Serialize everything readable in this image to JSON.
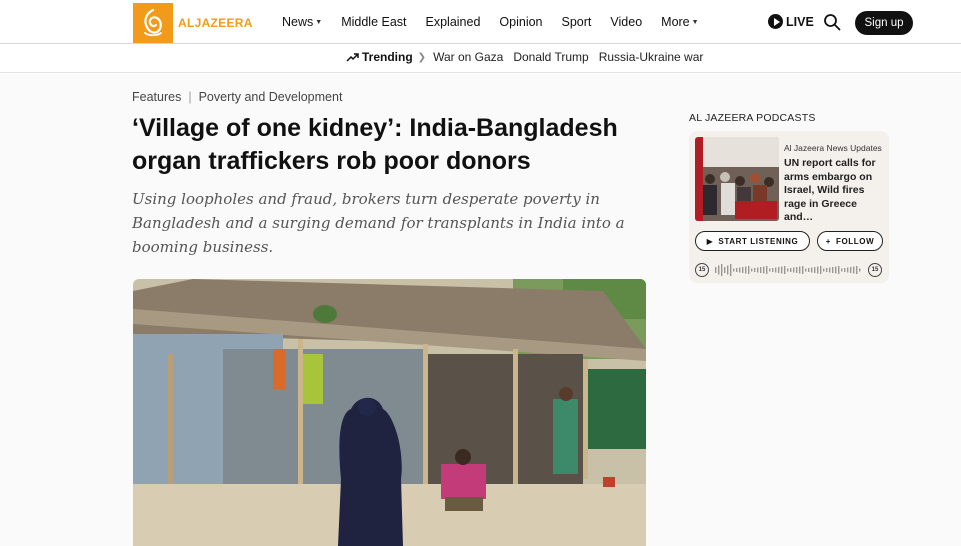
{
  "brand": {
    "name": "ALJAZEERA",
    "color": "#f29b1a"
  },
  "nav": {
    "items": [
      {
        "label": "News",
        "dropdown": true
      },
      {
        "label": "Middle East",
        "dropdown": false
      },
      {
        "label": "Explained",
        "dropdown": false
      },
      {
        "label": "Opinion",
        "dropdown": false
      },
      {
        "label": "Sport",
        "dropdown": false
      },
      {
        "label": "Video",
        "dropdown": false
      },
      {
        "label": "More",
        "dropdown": true
      }
    ],
    "live_label": "LIVE",
    "signup_label": "Sign up"
  },
  "trending": {
    "label": "Trending",
    "links": [
      "War on Gaza",
      "Donald Trump",
      "Russia-Ukraine war"
    ]
  },
  "article": {
    "breadcrumb": [
      "Features",
      "Poverty and Development"
    ],
    "headline": "‘Village of one kidney’: India-Bangladesh organ traffickers rob poor donors",
    "dek": "Using loopholes and fraud, brokers turn desperate poverty in Bangladesh and a surging demand for transplants in India into a booming business."
  },
  "podcast": {
    "section_title": "AL JAZEERA PODCASTS",
    "show_name": "Al Jazeera News Updates",
    "episode_title": "UN report calls for arms embargo on Israel, Wild fires rage in Greece and…",
    "listen_label": "START LISTENING",
    "follow_label": "FOLLOW",
    "skip_back": "15",
    "skip_forward": "15"
  }
}
